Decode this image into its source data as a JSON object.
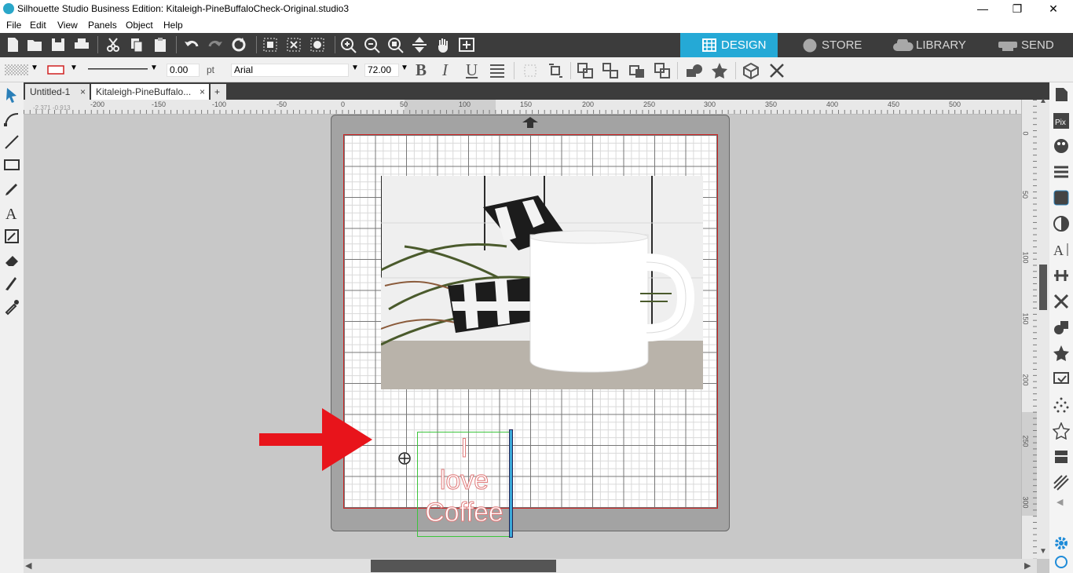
{
  "window": {
    "title": "Silhouette Studio Business Edition: Kitaleigh-PineBuffaloCheck-Original.studio3",
    "minimize": "—",
    "maximize": "❐",
    "close": "✕"
  },
  "menu": {
    "items": [
      "File",
      "Edit",
      "View",
      "Panels",
      "Object",
      "Help"
    ]
  },
  "nav_tabs": {
    "design": "DESIGN",
    "store": "STORE",
    "library": "LIBRARY",
    "send": "SEND"
  },
  "colors": {
    "accent": "#25a9d6",
    "toolbar_bg": "#3c3c3c",
    "cut_line": "#e07a7a",
    "selection": "#3cc43c",
    "arrow": "#e8141b"
  },
  "properties": {
    "line_width": "0.00",
    "line_unit": "pt",
    "font": "Arial",
    "font_size": "72.00",
    "bold": "B",
    "italic": "I",
    "underline": "U"
  },
  "doc_tabs": [
    {
      "label": "Untitled-1",
      "close": "×"
    },
    {
      "label": "Kitaleigh-PineBuffalo...",
      "close": "×"
    }
  ],
  "add_tab": "+",
  "ruler": {
    "h_labels": [
      "-200",
      "-150",
      "-100",
      "-50",
      "0",
      "50",
      "100",
      "150",
      "200",
      "250",
      "300",
      "350",
      "400",
      "450",
      "500"
    ],
    "v_labels": [
      "0",
      "50",
      "100",
      "150",
      "200",
      "250",
      "300"
    ],
    "coords": "-2.371  -0.913"
  },
  "canvas_text": {
    "line1": "I",
    "line2": "love",
    "line3": "Coffee"
  }
}
